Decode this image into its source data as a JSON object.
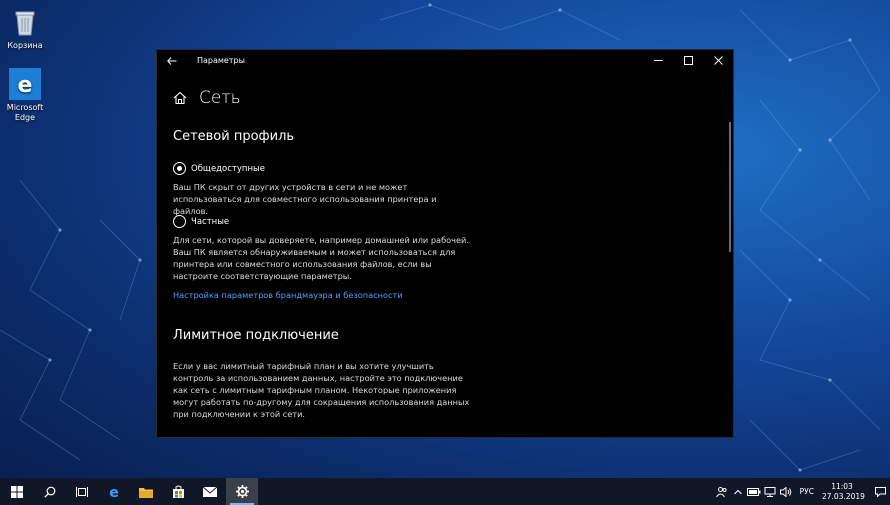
{
  "desktop": {
    "icons": [
      {
        "label": "Корзина",
        "icon": "recycle-bin-icon"
      },
      {
        "label": "Microsoft Edge",
        "icon": "edge-icon"
      }
    ]
  },
  "window": {
    "title": "Параметры",
    "page_title": "Сеть",
    "network_profile": {
      "heading": "Сетевой профиль",
      "public": {
        "label": "Общедоступные",
        "selected": true,
        "description": "Ваш ПК скрыт от других устройств в сети и не может использоваться для совместного использования принтера и файлов."
      },
      "private": {
        "label": "Частные",
        "selected": false,
        "description": "Для сети, которой вы доверяете, например домашней или рабочей. Ваш ПК является обнаруживаемым и может использоваться для принтера или совместного использования файлов, если вы настроите соответствующие параметры."
      },
      "firewall_link": "Настройка параметров брандмауэра и безопасности"
    },
    "metered": {
      "heading": "Лимитное подключение",
      "description": "Если у вас лимитный тарифный план и вы хотите улучшить контроль за использованием данных, настройте это подключение как сеть с лимитным тарифным планом. Некоторые приложения могут работать по-другому для сокращения использования данных при подключении к этой сети."
    }
  },
  "taskbar": {
    "apps": [
      "start-icon",
      "search-icon",
      "task-view-icon",
      "edge-icon",
      "file-explorer-icon",
      "store-icon",
      "mail-icon",
      "settings-icon"
    ],
    "language": "РУС",
    "time": "11:03",
    "date": "27.03.2019",
    "accent": "#7fb2ff"
  }
}
